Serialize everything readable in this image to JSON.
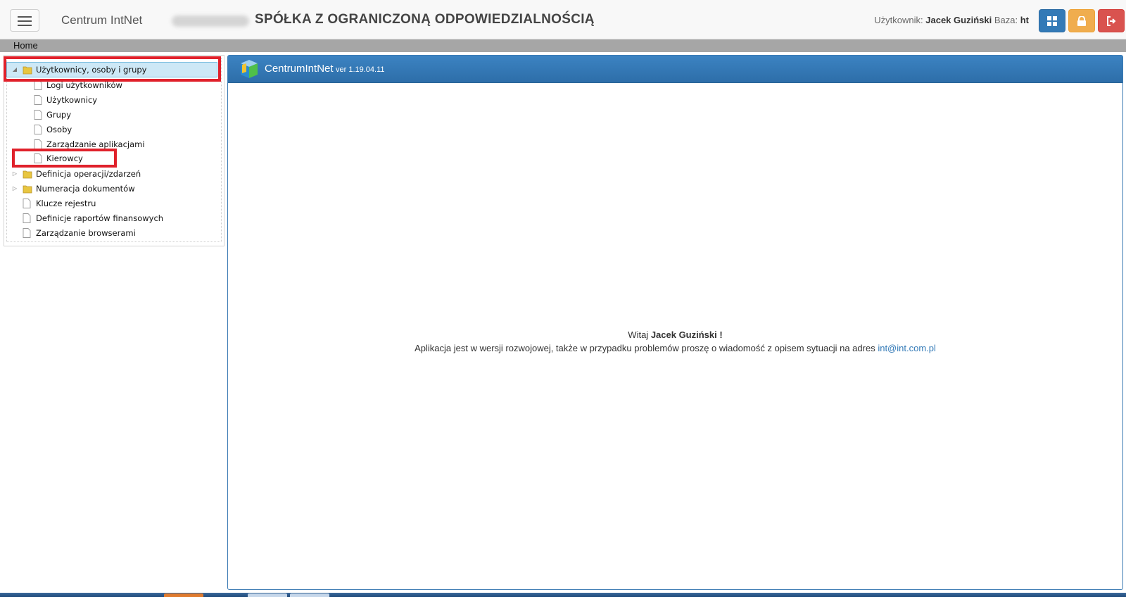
{
  "navbar": {
    "brand": "Centrum IntNet",
    "company_name": "SPÓŁKA Z OGRANICZONĄ ODPOWIEDZIALNOŚCIĄ",
    "user_label": "Użytkownik:",
    "user_name": "Jacek Guziński",
    "db_label": "Baza:",
    "db_value": "ht",
    "buttons": {
      "blue": "grid-icon",
      "orange": "lock-icon",
      "red": "logout-icon"
    }
  },
  "breadcrumb": {
    "home": "Home"
  },
  "tree": {
    "root": "Użytkownicy, osoby i grupy",
    "children": [
      "Logi użytkowników",
      "Użytkownicy",
      "Grupy",
      "Osoby",
      "Zarządzanie aplikacjami",
      "Kierowcy"
    ],
    "folders": [
      "Definicja operacji/zdarzeń",
      "Numeracja dokumentów"
    ],
    "docs": [
      "Klucze rejestru",
      "Definicje raportów finansowych",
      "Zarządzanie browserami"
    ]
  },
  "main": {
    "app_name": "CentrumIntNet",
    "version": "ver 1.19.04.11",
    "greeting_prefix": "Witaj",
    "greeting_name": "Jacek Guziński !",
    "message": "Aplikacja jest w wersji rozwojowej, także w przypadku problemów proszę o wiadomość z opisem sytuacji na adres",
    "email": "int@int.com.pl"
  },
  "colors": {
    "highlight": "#e0212b",
    "panel_header": "#337ab7",
    "selected": "#cde8f6"
  }
}
